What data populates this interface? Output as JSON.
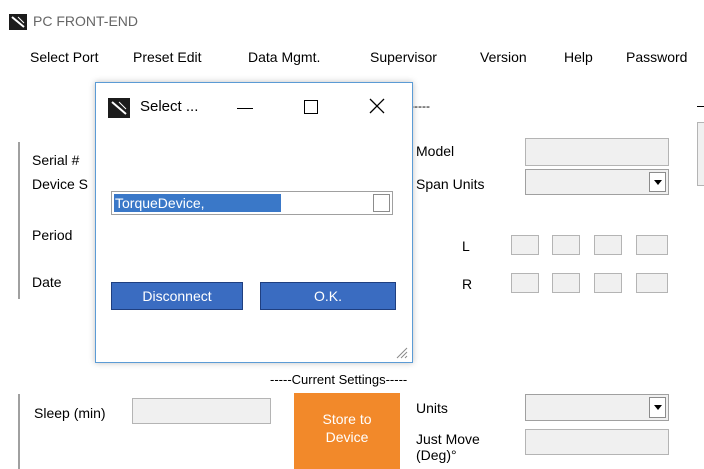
{
  "window": {
    "title": "PC FRONT-END"
  },
  "menu": [
    "Select Port",
    "Preset Edit",
    "Data Mgmt.",
    "Supervisor",
    "Version",
    "Help",
    "Password"
  ],
  "left": {
    "serial": "Serial #",
    "device": "Device S",
    "period": "Period",
    "date": "Date"
  },
  "top_section": {
    "header_fragment": "-----"
  },
  "right": {
    "model": "Model",
    "span_units": "Span Units",
    "l": "L",
    "r": "R"
  },
  "current_settings": {
    "header": "-----Current Settings-----",
    "sleep": "Sleep (min)",
    "store_button": "Store to Device",
    "units": "Units",
    "just_move": "Just Move (Deg)°"
  },
  "dialog": {
    "title": "Select ...",
    "combo_value": "TorqueDevice,",
    "disconnect": "Disconnect",
    "ok": "O.K."
  },
  "colors": {
    "accent_orange": "#f2892a",
    "dialog_button_blue": "#3a6cc1",
    "selection_blue": "#3a78c8"
  }
}
